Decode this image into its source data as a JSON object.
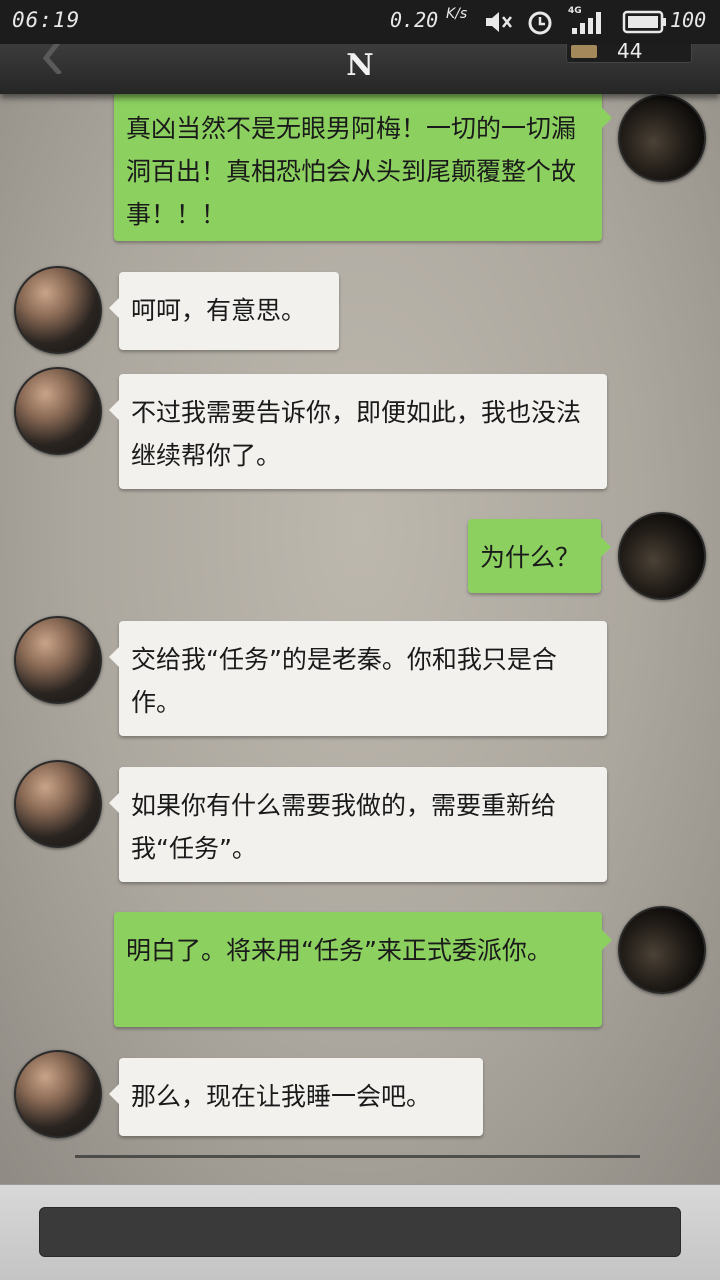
{
  "status_bar": {
    "time": "06:19",
    "net_speed": "0.20",
    "net_unit": "K/s",
    "network_type": "4G",
    "battery_level": "100"
  },
  "nav": {
    "title": "N",
    "counter": "44"
  },
  "messages": [
    {
      "side": "out",
      "text": "真凶当然不是无眼男阿梅！一切的一切漏洞百出！真相恐怕会从头到尾颠覆整个故事！！！"
    },
    {
      "side": "in",
      "text": "呵呵，有意思。"
    },
    {
      "side": "in",
      "text": "不过我需要告诉你，即便如此，我也没法继续帮你了。"
    },
    {
      "side": "out",
      "text": "为什么？"
    },
    {
      "side": "in",
      "text": "交给我“任务”的是老秦。你和我只是合作。"
    },
    {
      "side": "in",
      "text": "如果你有什么需要我做的，需要重新给我“任务”。"
    },
    {
      "side": "out",
      "text": "明白了。将来用“任务”来正式委派你。"
    },
    {
      "side": "in",
      "text": "那么，现在让我睡一会吧。"
    }
  ],
  "input": {
    "value": ""
  }
}
